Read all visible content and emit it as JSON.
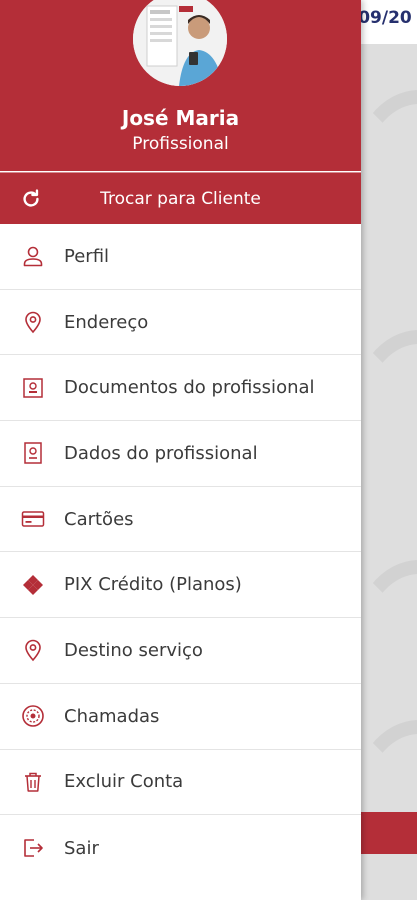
{
  "background": {
    "date_fragment": "/09/20"
  },
  "user": {
    "name": "José Maria",
    "role": "Profissional"
  },
  "switch": {
    "label": "Trocar para Cliente",
    "icon": "refresh-icon"
  },
  "menu": {
    "items": [
      {
        "label": "Perfil",
        "icon": "user-icon"
      },
      {
        "label": "Endereço",
        "icon": "location-pin-icon"
      },
      {
        "label": "Documentos do profissional",
        "icon": "document-icon"
      },
      {
        "label": "Dados do profissional",
        "icon": "id-card-icon"
      },
      {
        "label": "Cartões",
        "icon": "credit-card-icon"
      },
      {
        "label": "PIX Crédito (Planos)",
        "icon": "pix-icon"
      },
      {
        "label": "Destino serviço",
        "icon": "location-pin-icon"
      },
      {
        "label": "Chamadas",
        "icon": "calls-icon"
      },
      {
        "label": "Excluir Conta",
        "icon": "trash-icon"
      },
      {
        "label": "Sair",
        "icon": "logout-icon"
      }
    ]
  },
  "colors": {
    "primary": "#b42e38",
    "text": "#3b3b3b",
    "icon": "#b42e38"
  }
}
